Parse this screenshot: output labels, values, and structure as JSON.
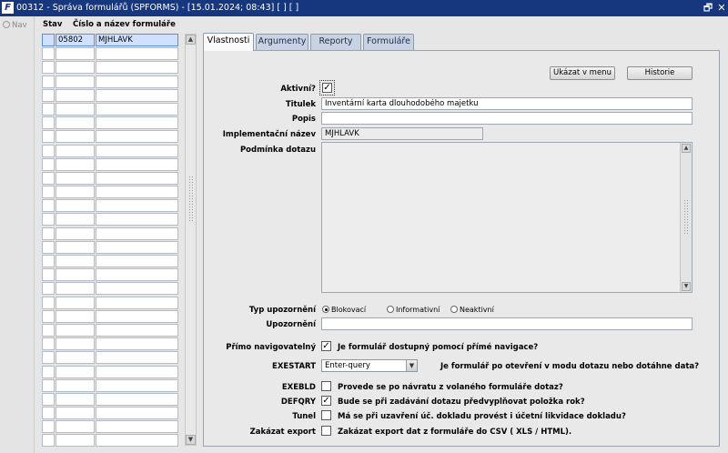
{
  "window": {
    "title": "00312 - Správa formulářů (SPFORMS) - [15.01.2024; 08:43]  [ ]  [ ]",
    "app_icon": "app-icon",
    "restore_glyph": "🗗",
    "close_glyph": "✕"
  },
  "nav": {
    "label": "Nav"
  },
  "grid": {
    "header_state": "Stav",
    "header_number_name": "Číslo a název formuláře",
    "rows": [
      {
        "state": "",
        "number": "05802",
        "name": "MJHLAVK"
      }
    ],
    "empty_row_count": 29
  },
  "tabs": [
    {
      "label": "Vlastnosti",
      "active": true
    },
    {
      "label": "Argumenty",
      "active": false
    },
    {
      "label": "Reporty",
      "active": false
    },
    {
      "label": "Formuláře",
      "active": false
    }
  ],
  "buttons": {
    "show_in_menu": "Ukázat v menu",
    "history": "Historie"
  },
  "form": {
    "active_label": "Aktivní?",
    "active_checked": true,
    "title_label": "Titulek",
    "title_value": "Inventární karta dlouhodobého majetku",
    "description_label": "Popis",
    "description_value": "",
    "impl_name_label": "Implementační název",
    "impl_name_value": "MJHLAVK",
    "query_condition_label": "Podmínka dotazu",
    "query_condition_value": "",
    "warning_type_label": "Typ upozornění",
    "warning_options": [
      {
        "label": "Blokovací",
        "selected": true
      },
      {
        "label": "Informativní",
        "selected": false
      },
      {
        "label": "Neaktivní",
        "selected": false
      }
    ],
    "warning_label": "Upozornění",
    "warning_value": "",
    "direct_nav_label": "Přímo navigovatelný",
    "direct_nav_checked": true,
    "direct_nav_text": "Je formulář dostupný pomocí přímé navigace?",
    "exestart_label": "EXESTART",
    "exestart_value": "Enter-query",
    "exestart_text": "Je formulář po otevření v modu dotazu nebo dotáhne data?",
    "exebld_label": "EXEBLD",
    "exebld_checked": false,
    "exebld_text": "Provede se po návratu z volaného formuláře dotaz?",
    "defqry_label": "DEFQRY",
    "defqry_checked": true,
    "defqry_text": "Bude se při zadávání dotazu předvyplňovat položka rok?",
    "tunel_label": "Tunel",
    "tunel_checked": false,
    "tunel_text": "Má se při uzavření úč. dokladu provést i účetní likvidace dokladu?",
    "export_label": "Zakázat export",
    "export_checked": false,
    "export_text": "Zakázat export dat z formuláře do CSV ( XLS / HTML)."
  }
}
